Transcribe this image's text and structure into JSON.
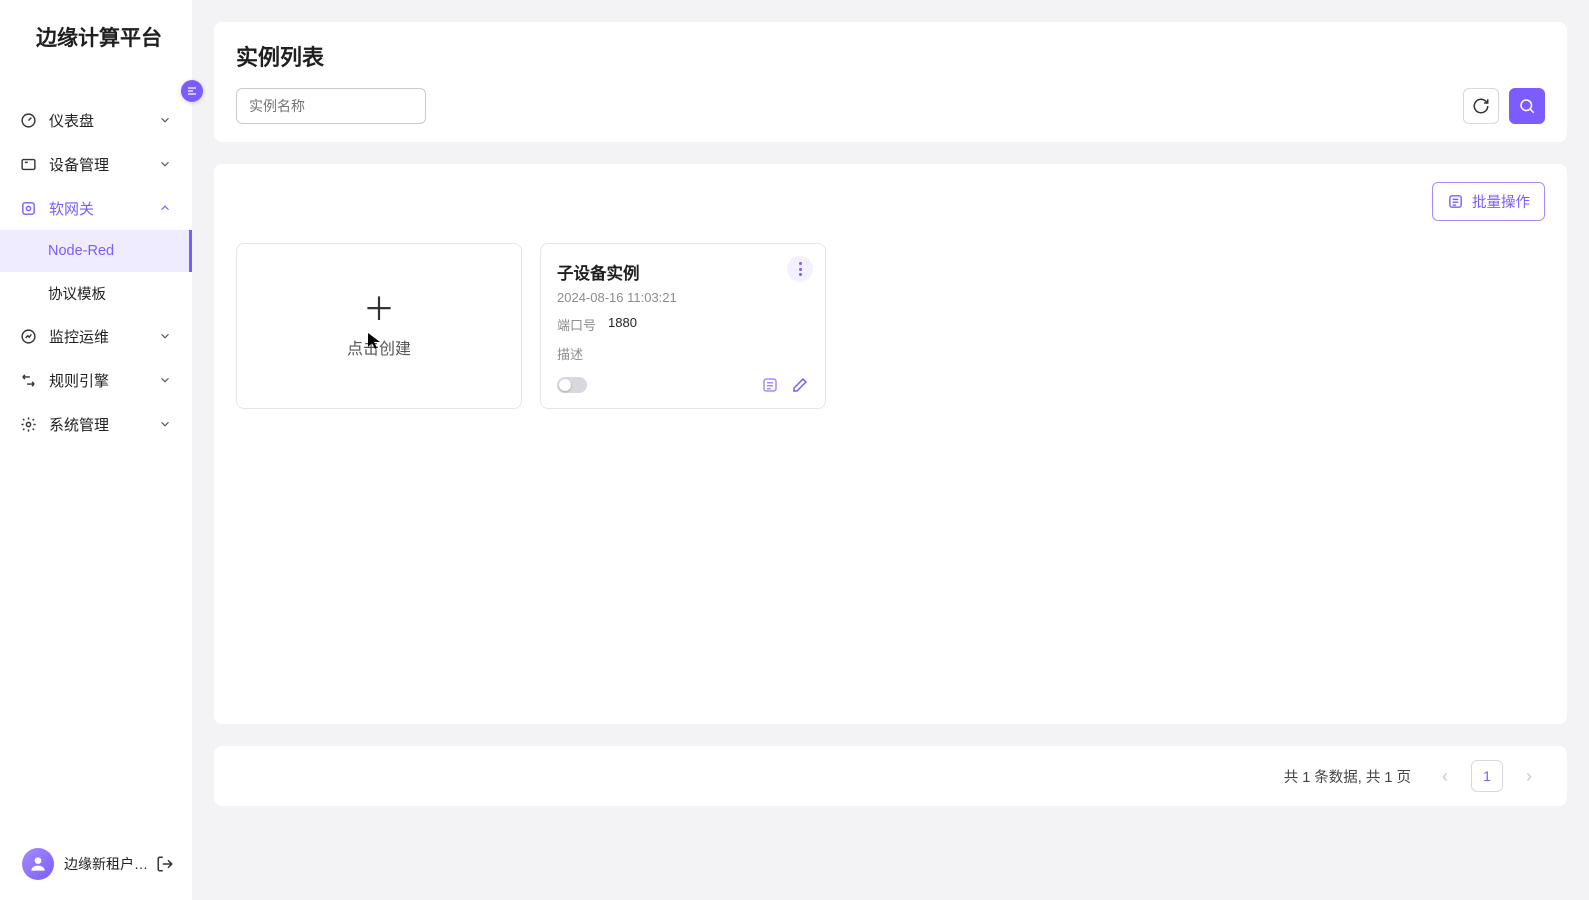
{
  "brand": "边缘计算平台",
  "nav": {
    "items": [
      {
        "label": "仪表盘",
        "icon": "gauge",
        "expanded": false
      },
      {
        "label": "设备管理",
        "icon": "device",
        "expanded": false
      },
      {
        "label": "软网关",
        "icon": "gateway",
        "expanded": true,
        "active": true,
        "children": [
          {
            "label": "Node-Red",
            "active": true
          },
          {
            "label": "协议模板",
            "active": false
          }
        ]
      },
      {
        "label": "监控运维",
        "icon": "monitor",
        "expanded": false
      },
      {
        "label": "规则引擎",
        "icon": "rules",
        "expanded": false
      },
      {
        "label": "系统管理",
        "icon": "system",
        "expanded": false
      }
    ]
  },
  "user": {
    "name": "边缘新租户管…"
  },
  "header": {
    "title": "实例列表",
    "search_placeholder": "实例名称"
  },
  "batch_label": "批量操作",
  "create_card": {
    "label": "点击创建"
  },
  "instances": [
    {
      "name": "子设备实例",
      "timestamp": "2024-08-16 11:03:21",
      "port_label": "端口号",
      "port_value": "1880",
      "desc_label": "描述",
      "enabled": false
    }
  ],
  "pagination": {
    "summary": "共 1 条数据, 共 1 页",
    "current": "1"
  }
}
